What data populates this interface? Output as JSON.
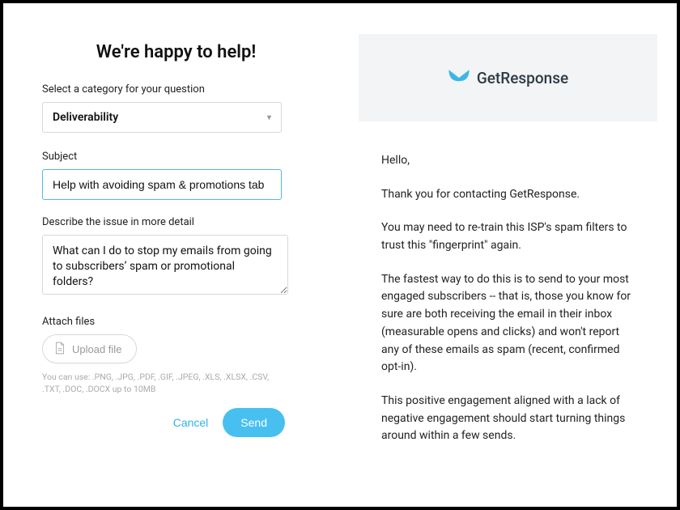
{
  "form": {
    "title": "We're happy to help!",
    "category_label": "Select a category for your question",
    "category_value": "Deliverability",
    "subject_label": "Subject",
    "subject_value": "Help with avoiding spam & promotions tab",
    "describe_label": "Describe the issue in more detail",
    "describe_value": "What can I do to stop my emails from going to subscribers’ spam or promotional folders?",
    "attach_label": "Attach files",
    "upload_label": "Upload file",
    "hint": "You can use: .PNG, .JPG, .PDF, .GIF, .JPEG, .XLS, .XLSX, .CSV, .TXT, .DOC, .DOCX up to 10MB",
    "cancel_label": "Cancel",
    "send_label": "Send"
  },
  "brand": {
    "name": "GetResponse"
  },
  "reply": {
    "greeting": "Hello,",
    "p1": "Thank you for contacting GetResponse.",
    "p2": "You may need to re-train this ISP's spam filters to trust this \"fingerprint\" again.",
    "p3": "The fastest way to do this is to send to your most engaged subscribers -- that is, those you know for sure are both receiving the email in their inbox (measurable opens and clicks) and won't report any of these emails as spam (recent, confirmed opt-in).",
    "p4": "This positive engagement aligned with a lack of negative engagement should start turning things around within a few sends."
  }
}
